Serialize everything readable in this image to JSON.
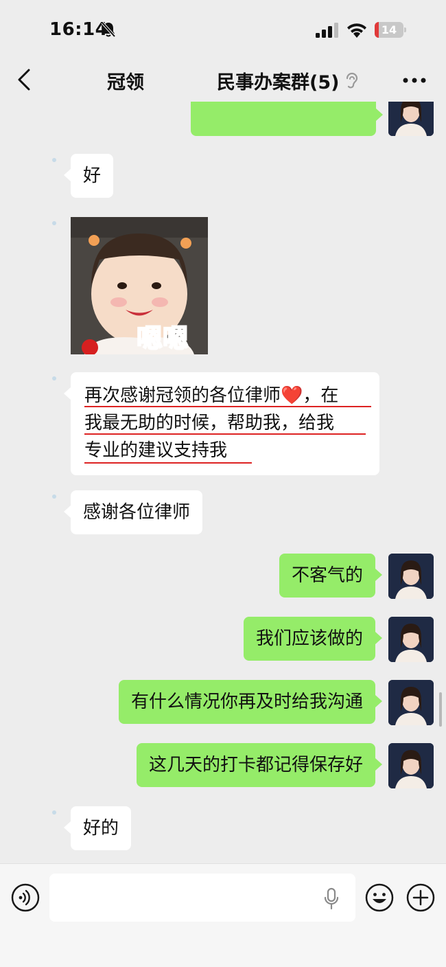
{
  "status_bar": {
    "time": "16:14",
    "battery_level": "14",
    "battery_fraction": 0.14,
    "icons": [
      "mute-icon",
      "signal-icon",
      "wifi-icon",
      "battery-icon"
    ]
  },
  "nav": {
    "back_icon": "chevron-left-icon",
    "left_title": "冠领",
    "title": "民事办案群(5)",
    "ear_icon": "ear-icon",
    "more_icon": "more-icon"
  },
  "messages": [
    {
      "side": "out",
      "text": ""
    },
    {
      "side": "in",
      "text": "好"
    },
    {
      "side": "in",
      "type": "sticker",
      "text": "嗯嗯"
    },
    {
      "side": "in",
      "lines": [
        "再次感谢冠领的各位律师❤️，在",
        "我最无助的时候，帮助我，给我",
        "专业的建议支持我"
      ]
    },
    {
      "side": "in",
      "text": "感谢各位律师"
    },
    {
      "side": "out",
      "text": "不客气的"
    },
    {
      "side": "out",
      "text": "我们应该做的"
    },
    {
      "side": "out",
      "text": "有什么情况你再及时给我沟通"
    },
    {
      "side": "out",
      "text": "这几天的打卡都记得保存好"
    },
    {
      "side": "in",
      "text": "好的"
    }
  ],
  "input_bar": {
    "placeholder": "",
    "voice_icon": "voice-icon",
    "mic_icon": "mic-icon",
    "emoji_icon": "emoji-icon",
    "plus_icon": "plus-icon"
  },
  "colors": {
    "background": "#ededed",
    "bubble_out": "#95ec69",
    "bubble_in": "#ffffff",
    "underline": "#dd2222",
    "battery_low": "#e03a3a"
  }
}
